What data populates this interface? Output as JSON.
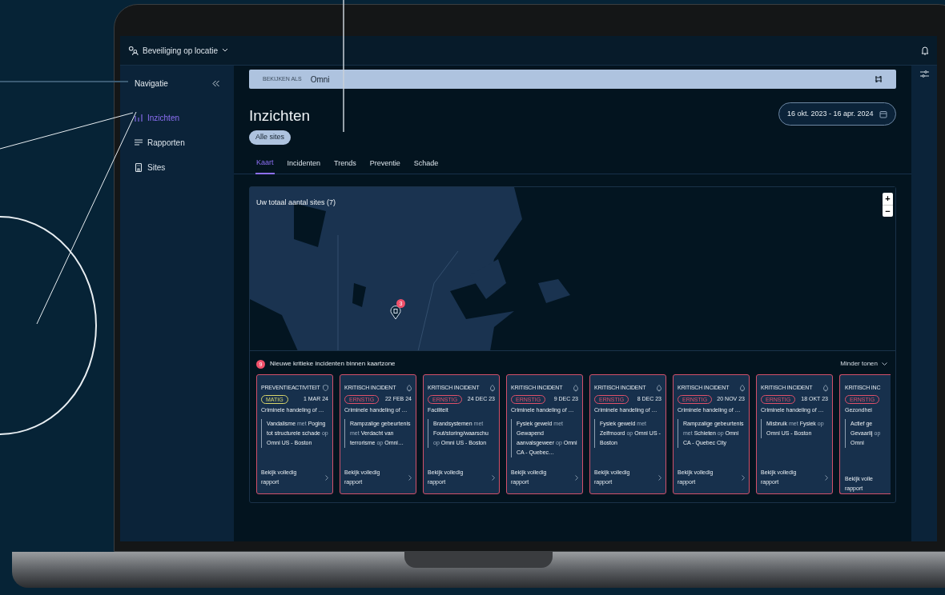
{
  "top_bar": {
    "app_title": "Beveiliging op locatie"
  },
  "sidebar": {
    "title": "Navigatie",
    "items": [
      {
        "label": "Inzichten",
        "selected": true
      },
      {
        "label": "Rapporten",
        "selected": false
      },
      {
        "label": "Sites",
        "selected": false
      }
    ]
  },
  "view_as": {
    "label": "BEKIJKEN ALS",
    "value": "Omni"
  },
  "page": {
    "title": "Inzichten",
    "filter_chip": "Alle sites",
    "date_range": "16 okt. 2023 - 16 apr. 2024"
  },
  "tabs": [
    {
      "label": "Kaart",
      "selected": true
    },
    {
      "label": "Incidenten",
      "selected": false
    },
    {
      "label": "Trends",
      "selected": false
    },
    {
      "label": "Preventie",
      "selected": false
    },
    {
      "label": "Schade",
      "selected": false
    }
  ],
  "map": {
    "title": "Uw totaal aantal sites (7)",
    "zoom_in": "+",
    "zoom_out": "−",
    "marker_count": "3"
  },
  "incidents": {
    "count": "9",
    "title": "Nieuwe kritieke incidenten binnen kaartzone",
    "toggle": "Minder tonen",
    "cards": [
      {
        "kind": "prevention",
        "clipped": false,
        "type": "PREVENTIEACTIVITEIT",
        "severity": {
          "label": "MATIG",
          "color": "#d9d66b"
        },
        "date": "1 MAR 24",
        "category": "Criminele handeling of …",
        "description": "**Vandalisme** met **Poging tot structurele schade** op **Omni US - Boston**",
        "link": "Bekijk volledig rapport"
      },
      {
        "kind": "incident",
        "clipped": false,
        "type": "KRITISCH INCIDENT",
        "severity": {
          "label": "ERNSTIG",
          "color": "#e0506a"
        },
        "date": "22 FEB 24",
        "category": "Criminele handeling of …",
        "description": "**Rampzalige gebeurtenis** met **Verdacht van terrorisme** op **Omni…**",
        "link": "Bekijk volledig rapport"
      },
      {
        "kind": "incident",
        "clipped": false,
        "type": "KRITISCH INCIDENT",
        "severity": {
          "label": "ERNSTIG",
          "color": "#e0506a"
        },
        "date": "24 DEC 23",
        "category": "Faciliteit",
        "description": "**Brandsystemen** met **Fout/storing/waarschu** op **Omni US - Boston**",
        "link": "Bekijk volledig rapport"
      },
      {
        "kind": "incident",
        "clipped": false,
        "type": "KRITISCH INCIDENT",
        "severity": {
          "label": "ERNSTIG",
          "color": "#e0506a"
        },
        "date": "9 DEC 23",
        "category": "Criminele handeling of …",
        "description": "**Fysiek geweld** met **Gewapend aanvalsgeweer** op **Omni CA - Quebec…**",
        "link": "Bekijk volledig rapport"
      },
      {
        "kind": "incident",
        "clipped": false,
        "type": "KRITISCH INCIDENT",
        "severity": {
          "label": "ERNSTIG",
          "color": "#e0506a"
        },
        "date": "8 DEC 23",
        "category": "Criminele handeling of …",
        "description": "**Fysiek geweld** met **Zelfmoord** op **Omni US - Boston**",
        "link": "Bekijk volledig rapport"
      },
      {
        "kind": "incident",
        "clipped": false,
        "type": "KRITISCH INCIDENT",
        "severity": {
          "label": "ERNSTIG",
          "color": "#e0506a"
        },
        "date": "20 NOV 23",
        "category": "Criminele handeling of …",
        "description": "**Rampzalige gebeurtenis** met **Schieten** op **Omni CA - Quebec City**",
        "link": "Bekijk volledig rapport"
      },
      {
        "kind": "incident",
        "clipped": false,
        "type": "KRITISCH INCIDENT",
        "severity": {
          "label": "ERNSTIG",
          "color": "#e0506a"
        },
        "date": "18 OKT 23",
        "category": "Criminele handeling of …",
        "description": "**Misbruik** met **Fysiek** op **Omni US - Boston**",
        "link": "Bekijk volledig rapport"
      },
      {
        "clipped": true,
        "type": "KRITISCH INC",
        "severity": {
          "label": "ERNSTIG",
          "color": "#e0506a"
        },
        "category": "Gezondhei",
        "description": "**Actief ge** **Gevaarlij** op **Omni**",
        "link": "Bekijk volle rapport"
      }
    ]
  }
}
